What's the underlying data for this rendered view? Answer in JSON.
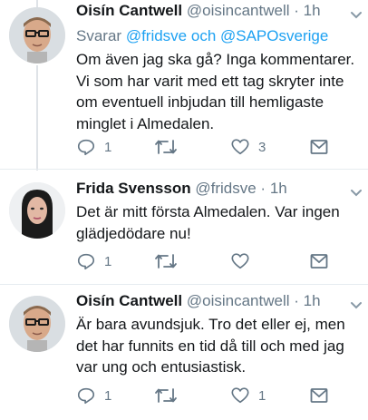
{
  "tweets": [
    {
      "name": "Oisín Cantwell",
      "handle": "@oisincantwell",
      "dot": "·",
      "time": "1h",
      "reply_prefix": "Svarar",
      "reply_to": "@fridsve och @SAPOsverige",
      "lines": [
        "Om även jag ska gå? Inga kommentarer.",
        "Vi som har varit med ett tag skryter inte",
        "om eventuell inbjudan till hemligaste",
        "minglet i Almedalen."
      ],
      "actions": {
        "reply": "1",
        "retweet": "",
        "like": "3",
        "dm": ""
      },
      "avatar": "man-glasses"
    },
    {
      "name": "Frida Svensson",
      "handle": "@fridsve",
      "dot": "·",
      "time": "1h",
      "lines": [
        "Det är mitt första Almedalen. Var ingen",
        "glädjedödare nu!"
      ],
      "actions": {
        "reply": "1",
        "retweet": "",
        "like": "",
        "dm": ""
      },
      "avatar": "woman-dark-hair"
    },
    {
      "name": "Oisín Cantwell",
      "handle": "@oisincantwell",
      "dot": "·",
      "time": "1h",
      "lines": [
        "Är bara avundsjuk. Tro det eller ej, men",
        "det har funnits en tid då till och med jag",
        "var ung och entusiastisk."
      ],
      "actions": {
        "reply": "1",
        "retweet": "",
        "like": "1",
        "dm": ""
      },
      "avatar": "man-glasses"
    }
  ],
  "colors": {
    "link": "#1da1f2",
    "muted": "#657786",
    "text": "#14171a"
  },
  "icons": [
    "reply-icon",
    "retweet-icon",
    "like-icon",
    "direct-message-icon",
    "chevron-down-icon"
  ]
}
